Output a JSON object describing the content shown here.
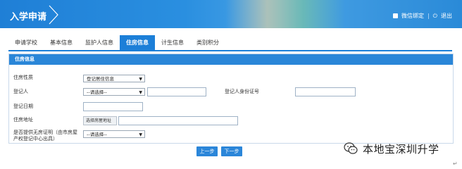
{
  "header": {
    "title": "入学申请",
    "wechat_bind": "微信绑定",
    "separator": "|",
    "logout": "退出"
  },
  "tabs": [
    {
      "label": "申请学校",
      "active": false
    },
    {
      "label": "基本信息",
      "active": false
    },
    {
      "label": "监护人信息",
      "active": false
    },
    {
      "label": "住房信息",
      "active": true
    },
    {
      "label": "计生信息",
      "active": false
    },
    {
      "label": "类别积分",
      "active": false
    }
  ],
  "panel": {
    "title": "住房信息",
    "fields": {
      "housing_type": {
        "label": "住房性质",
        "value": "登记居住信息"
      },
      "registrant": {
        "label": "登记人",
        "value": "--请选择--"
      },
      "registrant_id": {
        "label": "登记人身份证号",
        "value": ""
      },
      "registration_date": {
        "label": "登记日期",
        "value": ""
      },
      "address": {
        "label": "住房地址",
        "button": "选择房屋地址",
        "value": ""
      },
      "no_housing_proof": {
        "label_line1": "是否提供无房证明（由市房屋",
        "label_line2": "产权登记中心出具）",
        "value": "--请选择--"
      }
    }
  },
  "nav": {
    "prev": "上一步",
    "next": "下一步"
  },
  "watermark": {
    "text": "本地宝深圳升学",
    "icon": "wechat-icon"
  },
  "colors": {
    "primary": "#1c7fd8",
    "header": "#2a8fe0"
  }
}
